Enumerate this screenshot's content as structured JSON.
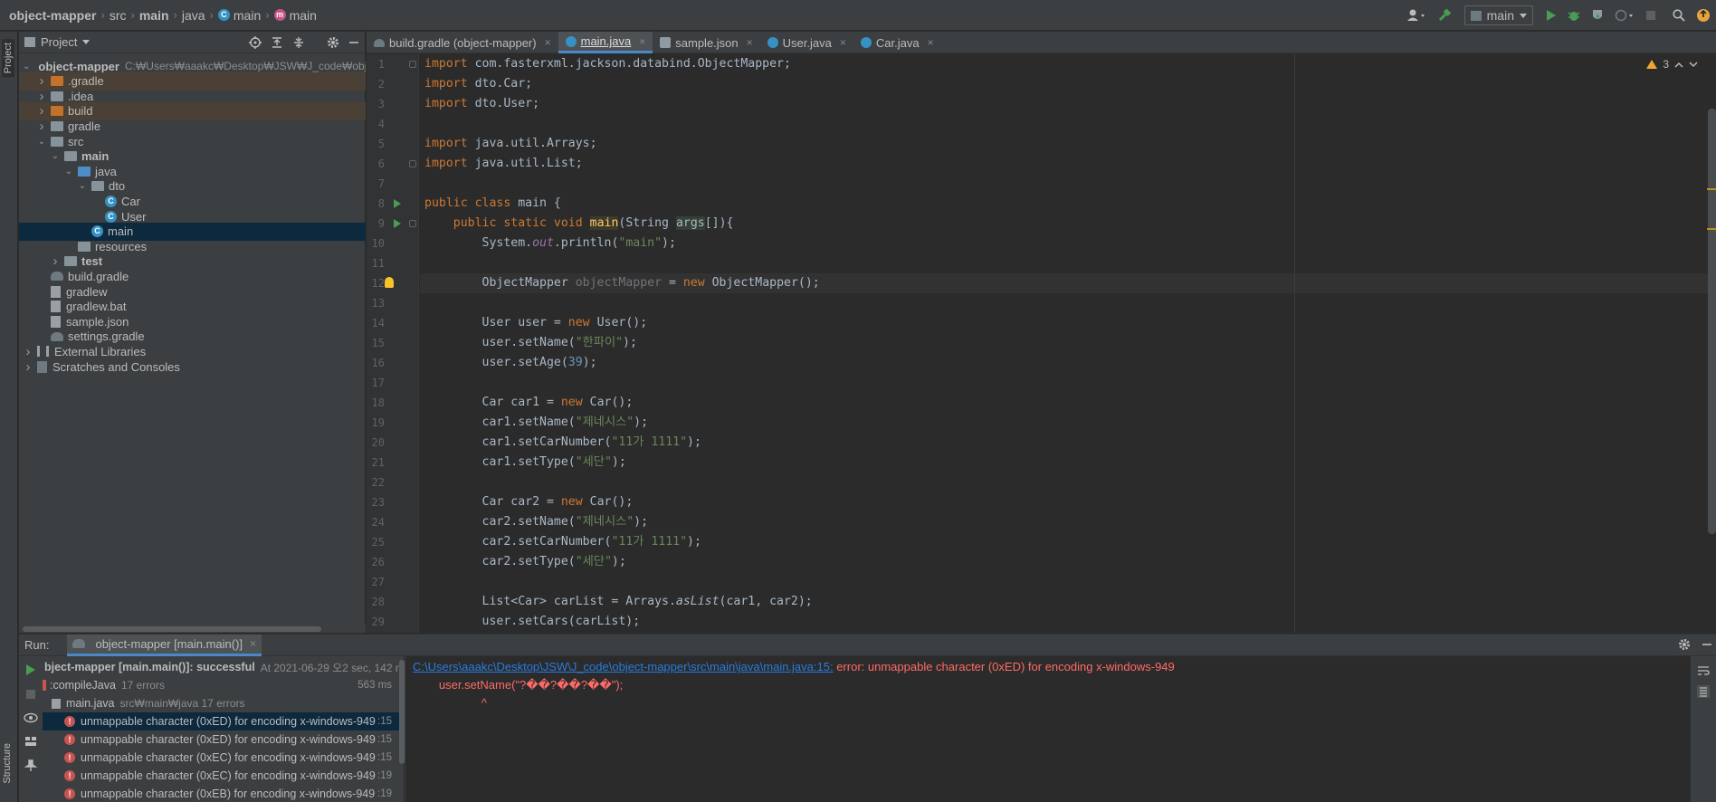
{
  "breadcrumb": [
    {
      "label": "object-mapper",
      "bold": true
    },
    {
      "label": "src"
    },
    {
      "label": "main",
      "bold": true
    },
    {
      "label": "java"
    },
    {
      "label": "main",
      "icon": "class"
    },
    {
      "label": "main",
      "icon": "method"
    }
  ],
  "toolbar": {
    "run_config": "main"
  },
  "side_tabs": {
    "project": "Project",
    "structure": "Structure"
  },
  "project_panel": {
    "title": "Project",
    "tree": [
      {
        "label": "object-mapper",
        "hint": "C:₩Users₩aaakc₩Desktop₩JSW₩J_code₩obje",
        "level": 0,
        "arrow": "down",
        "icon": "folder",
        "bold": true
      },
      {
        "label": ".gradle",
        "level": 1,
        "arrow": "right",
        "icon": "folder-orange",
        "excluded": true
      },
      {
        "label": ".idea",
        "level": 1,
        "arrow": "right",
        "icon": "folder"
      },
      {
        "label": "build",
        "level": 1,
        "arrow": "right",
        "icon": "folder-orange",
        "excluded": true
      },
      {
        "label": "gradle",
        "level": 1,
        "arrow": "right",
        "icon": "folder"
      },
      {
        "label": "src",
        "level": 1,
        "arrow": "down",
        "icon": "folder"
      },
      {
        "label": "main",
        "level": 2,
        "arrow": "down",
        "icon": "folder",
        "bold": true
      },
      {
        "label": "java",
        "level": 3,
        "arrow": "down",
        "icon": "folder-blue"
      },
      {
        "label": "dto",
        "level": 4,
        "arrow": "down",
        "icon": "folder-pkg"
      },
      {
        "label": "Car",
        "level": 5,
        "icon": "class"
      },
      {
        "label": "User",
        "level": 5,
        "icon": "class"
      },
      {
        "label": "main",
        "level": 4,
        "icon": "class",
        "selected": true
      },
      {
        "label": "resources",
        "level": 3,
        "icon": "folder"
      },
      {
        "label": "test",
        "level": 2,
        "arrow": "right",
        "icon": "folder",
        "bold": true
      },
      {
        "label": "build.gradle",
        "level": 1,
        "icon": "gradle"
      },
      {
        "label": "gradlew",
        "level": 1,
        "icon": "file"
      },
      {
        "label": "gradlew.bat",
        "level": 1,
        "icon": "file"
      },
      {
        "label": "sample.json",
        "level": 1,
        "icon": "file"
      },
      {
        "label": "settings.gradle",
        "level": 1,
        "icon": "gradle"
      },
      {
        "label": "External Libraries",
        "level": 0,
        "arrow": "right",
        "icon": "library"
      },
      {
        "label": "Scratches and Consoles",
        "level": 0,
        "arrow": "right",
        "icon": "scratch"
      }
    ]
  },
  "editor_tabs": [
    {
      "label": "build.gradle (object-mapper)",
      "icon": "gradle"
    },
    {
      "label": "main.java",
      "icon": "class",
      "active": true
    },
    {
      "label": "sample.json",
      "icon": "json"
    },
    {
      "label": "User.java",
      "icon": "class"
    },
    {
      "label": "Car.java",
      "icon": "class"
    }
  ],
  "editor": {
    "warning_count": "3",
    "current_line": 12,
    "lines": [
      {
        "n": "1",
        "html": "<span class=\"kw\">import</span> com.fasterxml.jackson.databind.ObjectMapper;"
      },
      {
        "n": "2",
        "html": "<span class=\"kw\">import</span> dto.Car;"
      },
      {
        "n": "3",
        "html": "<span class=\"kw\">import</span> dto.User;"
      },
      {
        "n": "4",
        "html": ""
      },
      {
        "n": "5",
        "html": "<span class=\"kw\">import</span> java.util.Arrays;"
      },
      {
        "n": "6",
        "html": "<span class=\"kw\">import</span> java.util.List;"
      },
      {
        "n": "7",
        "html": ""
      },
      {
        "n": "8",
        "html": "<span class=\"kw\">public class</span> main {"
      },
      {
        "n": "9",
        "html": "    <span class=\"kw\">public static void</span> <span class=\"fn-hl\">main</span>(String <span class=\"hl\">args</span>[]){"
      },
      {
        "n": "10",
        "html": "        System.<span class=\"ital\">out</span>.println(<span class=\"str\">\"main\"</span>);"
      },
      {
        "n": "11",
        "html": ""
      },
      {
        "n": "12",
        "html": "        ObjectMapper <span class=\"unused\">objectMapper</span> = <span class=\"kw\">new</span> ObjectMapper();"
      },
      {
        "n": "13",
        "html": ""
      },
      {
        "n": "14",
        "html": "        User user = <span class=\"kw\">new</span> User();"
      },
      {
        "n": "15",
        "html": "        user.setName(<span class=\"str\">\"한파이\"</span>);"
      },
      {
        "n": "16",
        "html": "        user.setAge(<span class=\"num\">39</span>);"
      },
      {
        "n": "17",
        "html": ""
      },
      {
        "n": "18",
        "html": "        Car car1 = <span class=\"kw\">new</span> Car();"
      },
      {
        "n": "19",
        "html": "        car1.setName(<span class=\"str\">\"제네시스\"</span>);"
      },
      {
        "n": "20",
        "html": "        car1.setCarNumber(<span class=\"str\">\"11가 1111\"</span>);"
      },
      {
        "n": "21",
        "html": "        car1.setType(<span class=\"str\">\"세단\"</span>);"
      },
      {
        "n": "22",
        "html": ""
      },
      {
        "n": "23",
        "html": "        Car car2 = <span class=\"kw\">new</span> Car();"
      },
      {
        "n": "24",
        "html": "        car2.setName(<span class=\"str\">\"제네시스\"</span>);"
      },
      {
        "n": "25",
        "html": "        car2.setCarNumber(<span class=\"str\">\"11가 1111\"</span>);"
      },
      {
        "n": "26",
        "html": "        car2.setType(<span class=\"str\">\"세단\"</span>);"
      },
      {
        "n": "27",
        "html": ""
      },
      {
        "n": "28",
        "html": "        List&lt;Car&gt; carList = Arrays.<span class=\"italc\">asList</span>(car1, car2);"
      },
      {
        "n": "29",
        "html": "        user.setCars(carList);"
      }
    ]
  },
  "run_panel": {
    "label": "Run:",
    "tab": "object-mapper [main.main()]",
    "tree": [
      {
        "label": "bject-mapper [main.main()]: successful",
        "dim": "At 2021-06-29 오2 sec, 142 ms",
        "level": 0,
        "bold": true
      },
      {
        "label": ":compileJava",
        "dim": "17 errors",
        "right": "563 ms",
        "level": 1,
        "icon": "err-small"
      },
      {
        "label": "main.java",
        "dim": "src₩main₩java 17 errors",
        "level": 2,
        "icon": "file"
      },
      {
        "label": "unmappable character (0xED) for encoding x-windows-949",
        "right": ":15",
        "level": 3,
        "icon": "error",
        "selected": true
      },
      {
        "label": "unmappable character (0xED) for encoding x-windows-949",
        "right": ":15",
        "level": 3,
        "icon": "error"
      },
      {
        "label": "unmappable character (0xEC) for encoding x-windows-949",
        "right": ":15",
        "level": 3,
        "icon": "error"
      },
      {
        "label": "unmappable character (0xEC) for encoding x-windows-949",
        "right": ":19",
        "level": 3,
        "icon": "error"
      },
      {
        "label": "unmappable character (0xEB) for encoding x-windows-949",
        "right": ":19",
        "level": 3,
        "icon": "error"
      }
    ],
    "console": {
      "link": "C:\\Users\\aaakc\\Desktop\\JSW\\J_code\\object-mapper\\src\\main\\java\\main.java:15:",
      "error": " error: unmappable character (0xED) for encoding x-windows-949",
      "line2": "        user.setName(\"?��?��?��\");",
      "line3": "                     ^"
    }
  },
  "colors": {
    "keyword": "#cc7832",
    "string": "#6a8759",
    "number": "#6897bb",
    "error": "#ff6b68",
    "link": "#287bde",
    "selection": "#0d293e",
    "accent": "#4a88c7"
  }
}
